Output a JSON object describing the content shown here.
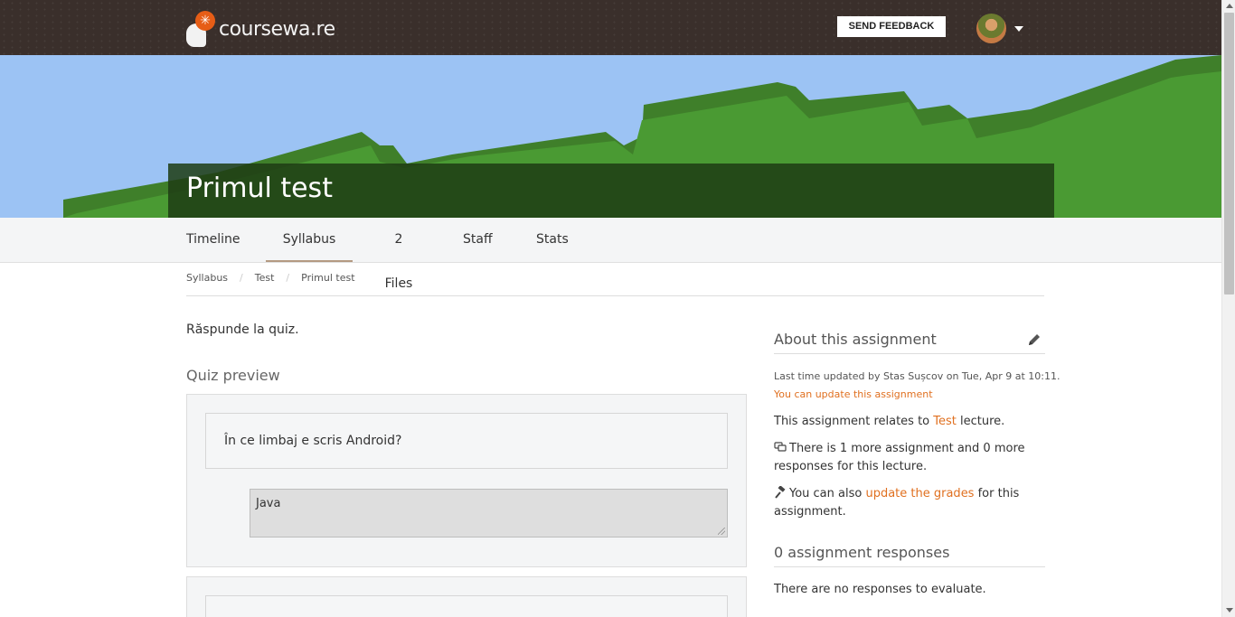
{
  "header": {
    "logo_text": "coursewa.re",
    "feedback_label": "SEND FEEDBACK"
  },
  "course": {
    "title": "Primul test"
  },
  "tabs": [
    {
      "label": "Timeline",
      "active": false
    },
    {
      "label": "Syllabus",
      "active": true
    },
    {
      "label": "2 Files",
      "active": false
    },
    {
      "label": "Staff",
      "active": false
    },
    {
      "label": "Stats",
      "active": false
    }
  ],
  "breadcrumb": [
    "Syllabus",
    "Test",
    "Primul test"
  ],
  "assignment": {
    "description": "Răspunde la quiz.",
    "quiz_heading": "Quiz preview",
    "question": "În ce limbaj e scris Android?",
    "answer": "Java"
  },
  "sidebar": {
    "about_heading": "About this assignment",
    "last_updated": "Last time updated by Stas Sușcov on Tue, Apr 9 at 10:11.",
    "can_update": "You can update this assignment",
    "relates_prefix": "This assignment relates to ",
    "relates_link": "Test",
    "relates_suffix": " lecture.",
    "more_assignments": "There is 1 more assignment and 0 more responses for this lecture.",
    "grades_prefix": "You can also ",
    "grades_link": "update the grades",
    "grades_suffix": " for this assignment.",
    "responses_heading": "0 assignment responses",
    "no_responses": "There are no responses to evaluate."
  },
  "colors": {
    "accent": "#e07020",
    "header_bg": "#3a2f2b",
    "sky": "#9cc3f4",
    "grass": "#4a9a33"
  },
  "icons": {
    "edit": "pencil-icon",
    "comments": "comments-icon",
    "grades": "gavel-icon"
  }
}
